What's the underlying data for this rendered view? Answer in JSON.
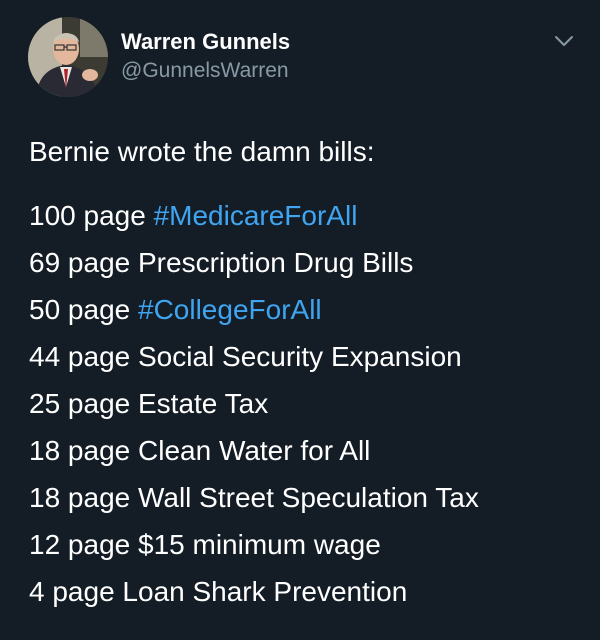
{
  "tweet": {
    "author": {
      "display_name": "Warren Gunnels",
      "handle": "@GunnelsWarren"
    },
    "intro": "Bernie wrote the damn bills:",
    "bills": [
      {
        "prefix": "100 page ",
        "text": "#MedicareForAll",
        "hashtag": true
      },
      {
        "prefix": "69 page ",
        "text": "Prescription Drug Bills",
        "hashtag": false
      },
      {
        "prefix": "50 page ",
        "text": "#CollegeForAll",
        "hashtag": true
      },
      {
        "prefix": "44 page ",
        "text": "Social Security Expansion",
        "hashtag": false
      },
      {
        "prefix": "25 page ",
        "text": "Estate Tax",
        "hashtag": false
      },
      {
        "prefix": "18 page ",
        "text": "Clean Water for All",
        "hashtag": false
      },
      {
        "prefix": "18 page ",
        "text": "Wall Street Speculation Tax",
        "hashtag": false
      },
      {
        "prefix": "12 page ",
        "text": "$15 minimum wage",
        "hashtag": false
      },
      {
        "prefix": "4 page ",
        "text": "Loan Shark Prevention",
        "hashtag": false
      }
    ]
  },
  "icons": {
    "menu": "chevron-down-icon"
  },
  "colors": {
    "background": "#141d26",
    "text": "#ffffff",
    "secondary_text": "#8899a6",
    "link": "#3fa5f0"
  }
}
